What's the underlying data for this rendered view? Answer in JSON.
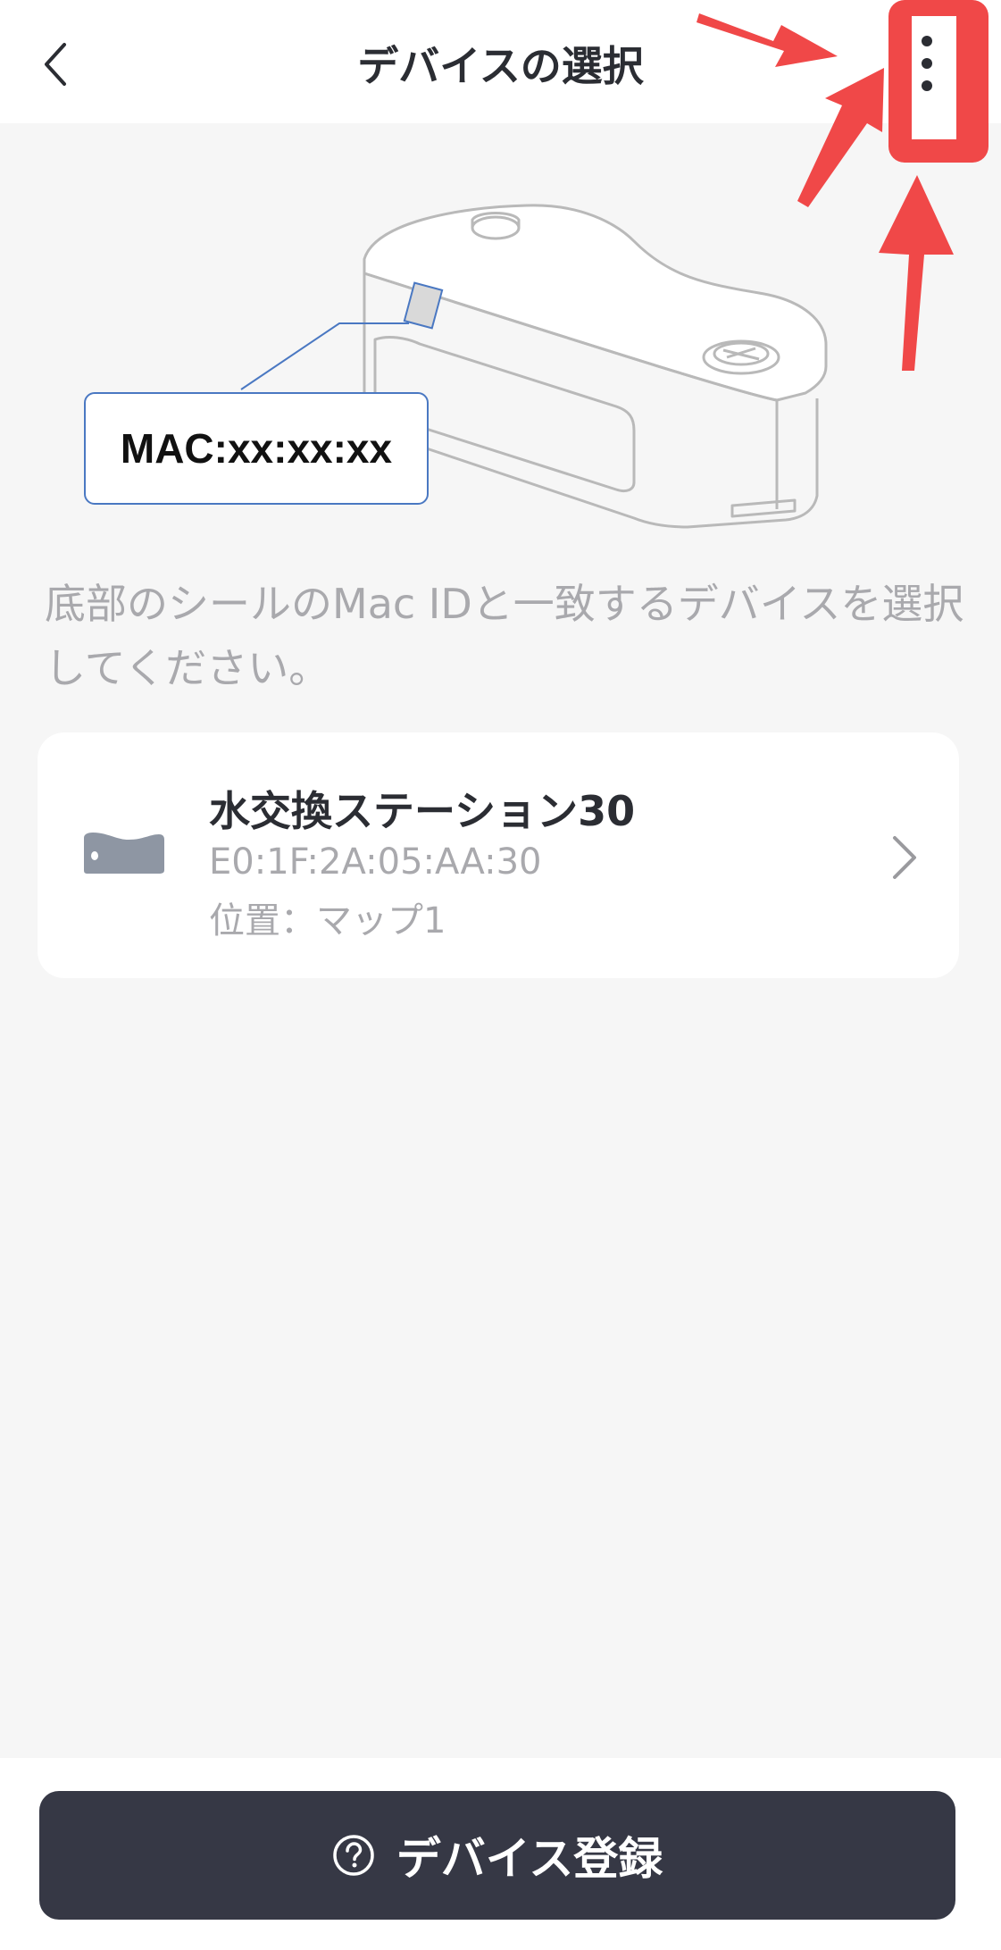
{
  "header": {
    "title": "デバイスの選択",
    "back_icon": "chevron-left-icon",
    "more_icon": "more-vertical-icon"
  },
  "illustration": {
    "mac_label": "MAC:xx:xx:xx"
  },
  "instruction": "底部のシールのMac IDと一致するデバイスを選択してください。",
  "device": {
    "name": "水交換ステーション30",
    "mac": "E0:1F:2A:05:AA:30",
    "location": "位置：マップ1",
    "icon": "water-station-icon"
  },
  "footer": {
    "register_label": "デバイス登録",
    "help_icon": "help-circle-icon"
  },
  "colors": {
    "background": "#f6f6f6",
    "title_text": "#2b2d33",
    "secondary_text": "#a9a9ad",
    "button_bg": "#363845",
    "annotation_red": "#f04848",
    "label_border": "#4a78c2"
  }
}
